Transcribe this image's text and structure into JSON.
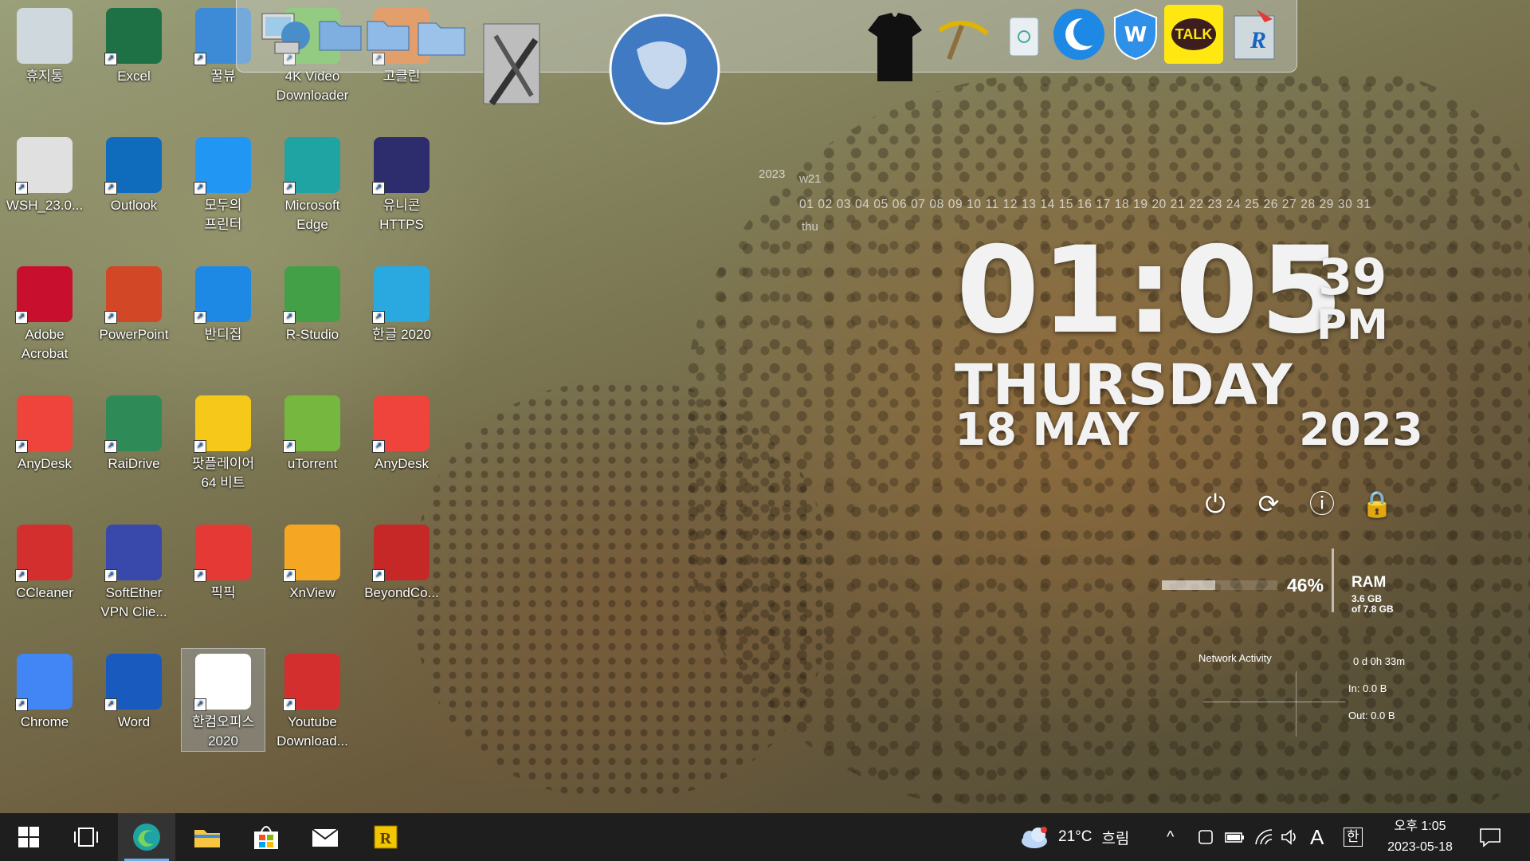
{
  "desktop_icons": [
    {
      "label": "휴지통",
      "icon": "recycle-bin-icon",
      "color": "#cfd8dc"
    },
    {
      "label": "Excel",
      "icon": "excel-icon",
      "color": "#1e7145"
    },
    {
      "label": "꿀뷰",
      "icon": "honeyview-icon",
      "color": "#3d8bd6"
    },
    {
      "label": "4K Video\nDownloader",
      "icon": "4k-video-downloader-icon",
      "color": "#6bbf4e"
    },
    {
      "label": "고클린",
      "icon": "goclean-icon",
      "color": "#e57c2c"
    },
    {
      "label": "WSH_23.0...",
      "icon": "file-icon",
      "color": "#e0e0e0"
    },
    {
      "label": "Outlook",
      "icon": "outlook-icon",
      "color": "#0f6cbd"
    },
    {
      "label": "모두의\n프린터",
      "icon": "printer-icon",
      "color": "#2196f3"
    },
    {
      "label": "Microsoft\nEdge",
      "icon": "edge-icon",
      "color": "#1fa3a3"
    },
    {
      "label": "유니콘\nHTTPS",
      "icon": "unicorn-https-icon",
      "color": "#2d2d6e"
    },
    {
      "label": "Adobe\nAcrobat",
      "icon": "acrobat-icon",
      "color": "#c8102e"
    },
    {
      "label": "PowerPoint",
      "icon": "powerpoint-icon",
      "color": "#d24726"
    },
    {
      "label": "반디집",
      "icon": "bandizip-icon",
      "color": "#1e88e5"
    },
    {
      "label": "R-Studio",
      "icon": "r-studio-icon",
      "color": "#43a047"
    },
    {
      "label": "한글 2020",
      "icon": "hangul-icon",
      "color": "#2aa8e0"
    },
    {
      "label": "AnyDesk",
      "icon": "anydesk-icon",
      "color": "#ef443b"
    },
    {
      "label": "RaiDrive",
      "icon": "raidrive-icon",
      "color": "#2e8b57"
    },
    {
      "label": "팟플레이어\n64 비트",
      "icon": "potplayer-icon",
      "color": "#f6c819"
    },
    {
      "label": "uTorrent",
      "icon": "utorrent-icon",
      "color": "#76b83f"
    },
    {
      "label": "AnyDesk",
      "icon": "anydesk-icon",
      "color": "#ef443b"
    },
    {
      "label": "CCleaner",
      "icon": "ccleaner-icon",
      "color": "#d32f2f"
    },
    {
      "label": "SoftEther\nVPN Clie...",
      "icon": "softether-icon",
      "color": "#3949ab"
    },
    {
      "label": "픽픽",
      "icon": "picpick-icon",
      "color": "#e53935"
    },
    {
      "label": "XnView",
      "icon": "xnview-icon",
      "color": "#f5a623"
    },
    {
      "label": "BeyondCo...",
      "icon": "beyond-compare-icon",
      "color": "#c62828"
    },
    {
      "label": "Chrome",
      "icon": "chrome-icon",
      "color": "#4285f4"
    },
    {
      "label": "Word",
      "icon": "word-icon",
      "color": "#185abd"
    },
    {
      "label": "한컴오피스\n2020",
      "icon": "hancom-office-icon",
      "color": "#ffffff"
    },
    {
      "label": "Youtube\nDownload...",
      "icon": "youtube-downloader-icon",
      "color": "#d32f2f"
    }
  ],
  "dock_items": [
    {
      "icon": "computer-network-icon"
    },
    {
      "icon": "folder-icon"
    },
    {
      "icon": "folder-icon"
    },
    {
      "icon": "folder-icon"
    },
    {
      "icon": "tools-icon"
    },
    {
      "icon": "globe-icon"
    },
    {
      "icon": "t-shirt-icon"
    },
    {
      "icon": "pickaxe-icon"
    },
    {
      "icon": "trash-icon"
    },
    {
      "icon": "moon-icon"
    },
    {
      "icon": "shield-icon"
    },
    {
      "icon": "kakaotalk-icon",
      "label": "TALK"
    },
    {
      "icon": "r-app-icon",
      "label": "R"
    }
  ],
  "clock": {
    "time": "01:05",
    "seconds": "39",
    "ampm": "PM",
    "day": "THURSDAY",
    "date": "18 MAY",
    "year": "2023"
  },
  "calendar_strip": {
    "year": "2023",
    "week": "w21",
    "weekday": "thu",
    "days": "01 02 03 04 05 06 07 08 09 10 11 12 13 14 15 16 17 18 19 20 21 22 23 24 25 26 27 28 29 30 31"
  },
  "system_widget": {
    "ram_percent": 46,
    "ram_percent_label": "46%",
    "ram_title": "RAM",
    "ram_used": "3.6 GB",
    "ram_total": "of 7.8 GB",
    "network_title": "Network Activity",
    "uptime": "0 d 0h 33m",
    "net_in": "In: 0.0 B",
    "net_out": "Out: 0.0 B"
  },
  "taskbar": {
    "weather_temp": "21°C",
    "weather_text": "흐림",
    "ime_letter": "A",
    "ime_lang": "한",
    "clock_time": "오후 1:05",
    "clock_date": "2023-05-18"
  }
}
